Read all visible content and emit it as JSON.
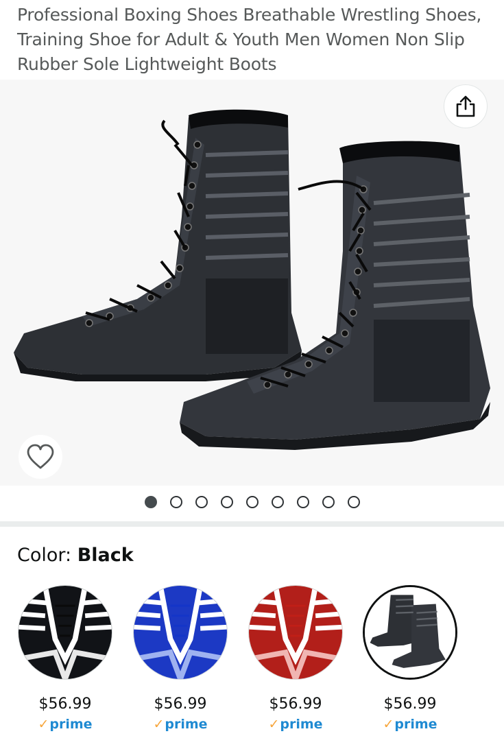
{
  "product": {
    "title": "Professional Boxing Shoes Breathable Wrestling Shoes, Training Shoe for Adult & Youth Men Women Non Slip Rubber Sole Lightweight Boots"
  },
  "gallery": {
    "image_count": 9,
    "active_index": 0,
    "share_icon": "share-icon",
    "favorite_icon": "heart-icon"
  },
  "color": {
    "label": "Color:",
    "selected": "Black"
  },
  "swatches": [
    {
      "color_name": "black-white-stripe",
      "price": "$56.99",
      "prime": "prime",
      "prime_check": "✓"
    },
    {
      "color_name": "blue-white-stripe",
      "price": "$56.99",
      "prime": "prime",
      "prime_check": "✓"
    },
    {
      "color_name": "red-white-stripe",
      "price": "$56.99",
      "prime": "prime",
      "prime_check": "✓"
    },
    {
      "color_name": "black",
      "price": "$56.99",
      "prime": "prime",
      "prime_check": "✓"
    }
  ],
  "colors": {
    "title_gray": "#565959",
    "gallery_bg": "#f7f7f7",
    "prime_blue": "#1f8ad2",
    "prime_check": "#f7a53a",
    "divider": "#eaeded"
  }
}
